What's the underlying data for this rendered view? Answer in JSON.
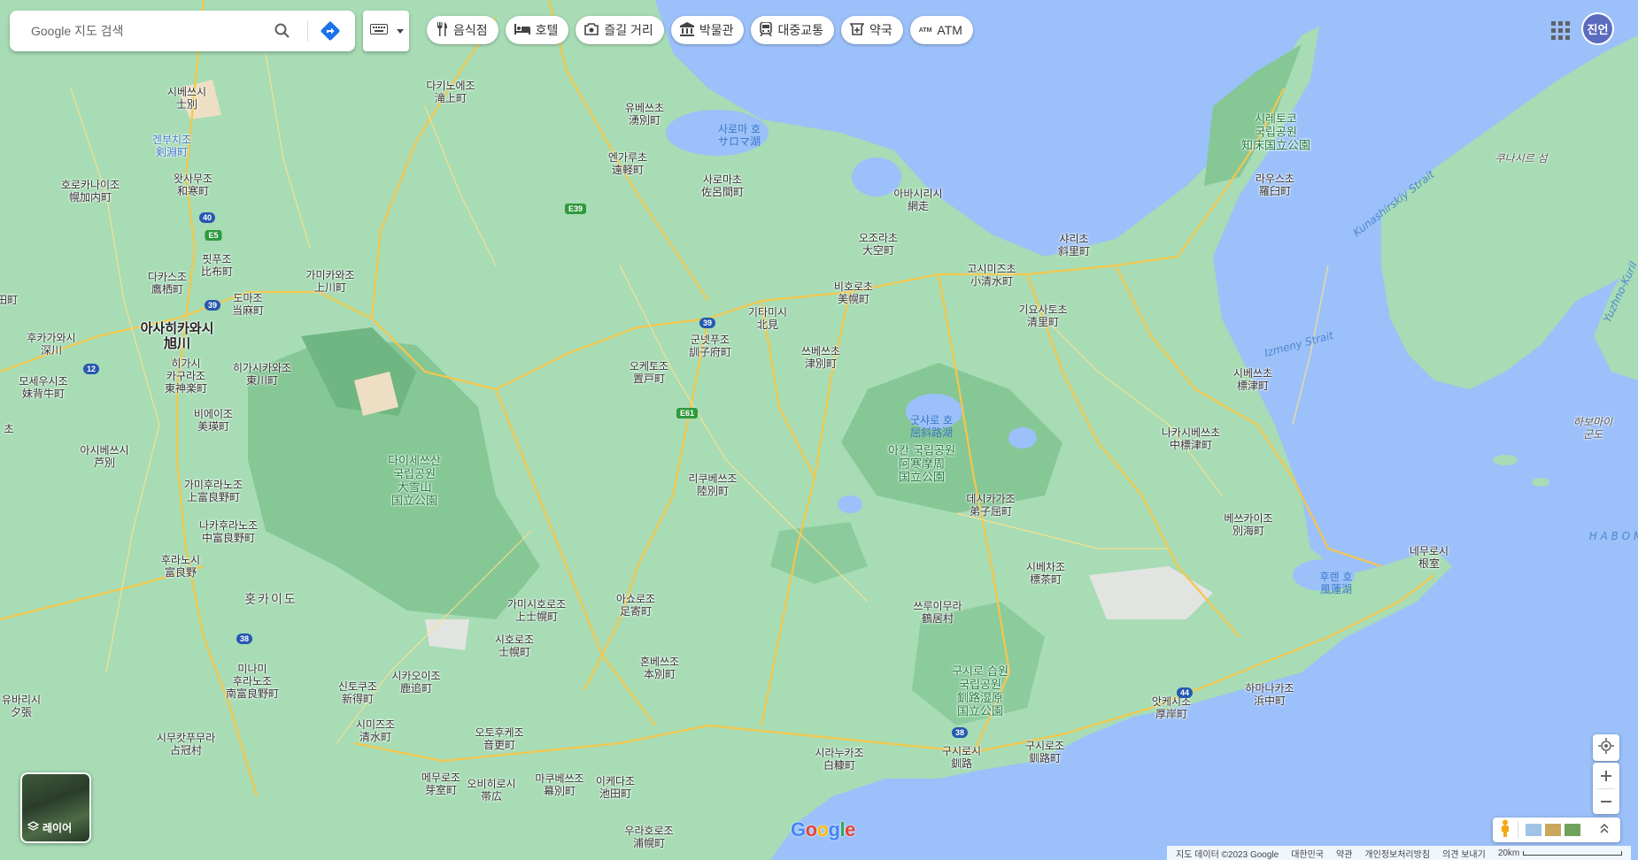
{
  "search": {
    "placeholder": "Google 지도 검색"
  },
  "chips": [
    {
      "icon": "restaurant-icon",
      "label": "음식점"
    },
    {
      "icon": "hotel-icon",
      "label": "호텔"
    },
    {
      "icon": "camera-icon",
      "label": "즐길 거리"
    },
    {
      "icon": "museum-icon",
      "label": "박물관"
    },
    {
      "icon": "transit-icon",
      "label": "대중교통"
    },
    {
      "icon": "pharmacy-icon",
      "label": "약국"
    },
    {
      "icon": "atm-icon",
      "label": "ATM"
    }
  ],
  "account": {
    "initials": "진언"
  },
  "layer_button": {
    "label": "레이어"
  },
  "footer": {
    "map_data": "지도 데이터 ©2023 Google",
    "country": "대한민국",
    "terms": "약관",
    "privacy": "개인정보처리방침",
    "feedback": "의견 보내기",
    "scale": "20km"
  },
  "logo": {
    "text": "Google"
  },
  "map_labels": {
    "asahikawa": "아사히카와시\n旭川",
    "kitami": "기타미시\n北見",
    "abashiri": "아바시리시\n網走",
    "kushiro_city": "구시로시\n釧路",
    "kushiro_town": "구시로조\n釧路町",
    "nemuro": "네무로시\n根室",
    "obihiro": "오비히로시\n帯広",
    "shibetsu_city": "시베쓰시\n士別",
    "takinoue": "다키노에조\n滝上町",
    "yubetsu": "유베쓰초\n湧別町",
    "engaru": "엔가루초\n遠軽町",
    "saroma_town": "사로마초\n佐呂間町",
    "ozora": "오조라초\n大空町",
    "koshimizu": "고시미즈초\n小清水町",
    "shari": "샤리초\n斜里町",
    "rausu": "라우스초\n羅臼町",
    "kiyosato": "기요사토초\n清里町",
    "bihoro": "비호로초\n美幌町",
    "tsubetsu": "쓰베쓰초\n津別町",
    "kunneppu": "군넷푸조\n訓子府町",
    "oketo": "오케토조\n置戸町",
    "rikubetsu": "리쿠베쓰조\n陸別町",
    "teshikaga": "데시카가조\n弟子屈町",
    "shibetsu_town": "시베쓰초\n標津町",
    "nakashibetsu": "나카시베쓰초\n中標津町",
    "betsukai": "베쓰카이조\n別海町",
    "shibecha": "시베차조\n標茶町",
    "tsurui": "쓰루이무라\n鶴居村",
    "akkeshi": "앗케시조\n厚岸町",
    "hamanaka": "하마나카조\n浜中町",
    "shiranuka": "시라누카조\n白糠町",
    "urahoro": "우라호로조\n浦幌町",
    "ikeda": "이케다조\n池田町",
    "makubetsu": "마쿠베쓰조\n幕別町",
    "memuro": "메무로조\n芽室町",
    "otofuke": "오토후케조\n音更町",
    "shimizu": "시미즈조\n清水町",
    "shintoku": "신토쿠조\n新得町",
    "shikaoi": "시카오이조\n鹿追町",
    "shihoro": "시호로조\n士幌町",
    "kamishihoro": "가미시호로조\n上士幌町",
    "ashoro": "아쇼로조\n足寄町",
    "honbetsu": "혼베쓰조\n本別町",
    "kamikawa": "가미카와조\n上川町",
    "aibetsu": "아이베쓰조\n愛別町",
    "pippu": "핏푸조\n比布町",
    "takasu": "다카스조\n鷹栖町",
    "touma": "도마조\n当麻町",
    "horokanai": "호로카나이조\n幌加内町",
    "wassamu": "왓사무조\n和寒町",
    "kenbuchi": "겐부치조\n剣淵町",
    "fukagawa": "후카가와시\n深川",
    "higashikagura": "히가시\n카구라조\n東神楽町",
    "higashikawa": "히가시카와조\n東川町",
    "biei": "비에이조\n美瑛町",
    "ashibetsu": "아시베쓰시\n芦別",
    "kamifurano": "가미후라노조\n上富良野町",
    "nakafurano": "나카후라노조\n中富良野町",
    "furano": "후라노시\n富良野",
    "minamifurano": "미나미\n후라노조\n南富良野町",
    "shimukappu": "시무캇푸무라\n占冠村",
    "yubari": "유바리시\n夕張",
    "moseushi": "모세우시조\n妹背牛町",
    "daisetsuzan_park": "다이세쓰산\n국립공원\n大雪山\n国立公園",
    "akan_park": "아칸 국립공원\n阿寒摩周\n国立公園",
    "shiretoko_park": "시레토코\n국립공원\n知床国立公園",
    "kushiro_park": "구시로 습원\n국립공원\n釧路湿原\n国立公園",
    "hokkaido": "홋카이도",
    "lake_saroma": "사로마 호\nサロマ湖",
    "lake_kussharo": "굿샤로 호\n屈斜路湖",
    "lake_furen": "후렌 호\n風蓮湖",
    "kunashiri_island": "쿠나시르 섬",
    "habomai": "하보마이\n군도",
    "kunashirsky_strait": "Kunashirskiy Strait",
    "izmeny_strait": "Izmeny Strait",
    "yuzhno": "Yuzhno-Kuril",
    "habo": "H A B O M",
    "route_e39": "E39",
    "route_e5": "E5",
    "route_e61": "E61",
    "route_40": "40",
    "route_39a": "39",
    "route_39b": "39",
    "route_12": "12",
    "route_38a": "38",
    "route_38b": "38",
    "route_44": "44",
    "edge_1": "田町",
    "edge_2": "초"
  }
}
